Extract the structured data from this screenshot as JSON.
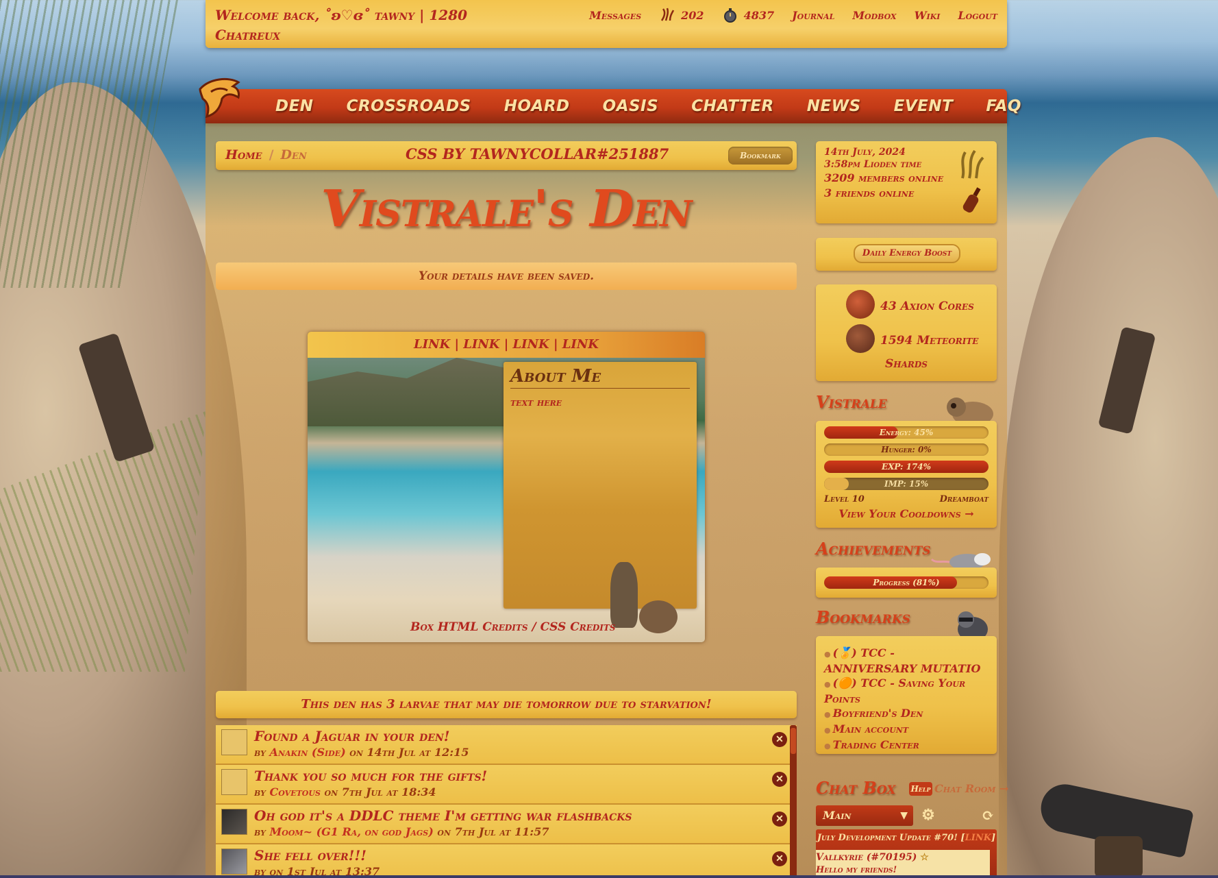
{
  "topbar": {
    "welcome": "Welcome back, ˚ʚ♡ɞ˚ tawny | 1280 Chatreux",
    "links": {
      "messages": "Messages",
      "currency1": "202",
      "currency2": "4837",
      "journal": "Journal",
      "modbox": "Modbox",
      "wiki": "Wiki",
      "logout": "Logout"
    }
  },
  "mainnav": {
    "items": [
      "DEN",
      "CROSSROADS",
      "HOARD",
      "OASIS",
      "CHATTER",
      "NEWS",
      "EVENT",
      "FAQ"
    ]
  },
  "breadcrumb": {
    "home": "Home",
    "separator": "/",
    "current": "Den",
    "credit": "CSS BY TAWNYCOLLAR#251887",
    "bookmark_button": "Bookmark"
  },
  "den": {
    "title": "Vistrale's Den",
    "saved_notice": "Your details have been saved.",
    "profile": {
      "links": "LINK | LINK | LINK | LINK",
      "about_title": "About Me",
      "about_text": "text here",
      "credits_box": "Box HTML Credits",
      "credits_sep": "/",
      "credits_css": "CSS Credits"
    },
    "larvae_notice": "This den has 3 larvae that may die tomorrow due to starvation!"
  },
  "messages": [
    {
      "title": "Found a Jaguar in your den!",
      "by": "by",
      "author": "Anakin (Side)",
      "when": "on 14th Jul at 12:15"
    },
    {
      "title": "Thank you so much for the gifts!",
      "by": "by",
      "author": "Covetous",
      "when": "on 7th Jul at 18:34"
    },
    {
      "title": "Oh god it's a DDLC theme I'm getting war flashbacks",
      "by": "by",
      "author": "Moom~ (G1 Ra, on god Jags)",
      "when": "on 7th Jul at 11:57"
    },
    {
      "title": "She fell over!!!",
      "by": "by",
      "author": "",
      "when": "on 1st Jul at 13:37"
    }
  ],
  "sidebar": {
    "info": {
      "date": "14th July, 2024",
      "time": "3:58pm Lioden time",
      "members_online": "3209 members online",
      "friends_online": "3 friends online"
    },
    "energy_button": "Daily Energy Boost",
    "currencies": {
      "axion": "43 Axion Cores",
      "meteorite_1": "1594 Meteorite",
      "meteorite_2": "Shards"
    },
    "pet": {
      "heading": "Vistrale",
      "energy_label": "Energy: 45%",
      "energy_value": 45,
      "hunger_label": "Hunger: 0%",
      "hunger_value": 0,
      "exp_label": "EXP: 174%",
      "exp_value": 100,
      "imp_label": "IMP: 15%",
      "imp_value": 15,
      "level": "Level 10",
      "type": "Dreamboat",
      "cooldowns": "View Your Cooldowns →"
    },
    "achievements": {
      "heading": "Achievements",
      "progress_label": "Progress (81%)",
      "progress_value": 81
    },
    "bookmarks": {
      "heading": "Bookmarks",
      "items": [
        "(🏅) TCC - ANNIVERSARY MUTATIO",
        "(🟠) TCC - Saving Your Points",
        "Boyfriend's Den",
        "Main account",
        "Trading Center"
      ]
    },
    "chat": {
      "heading": "Chat Box",
      "help": "Help",
      "room_link": "Chat Room →",
      "selected_room": "Main",
      "announcement": "July Development Update #70! [",
      "announcement_link": "LINK",
      "announcement_end": "]",
      "last_author": "Vallkyrie (#70195)",
      "last_text": "Hello my friends!"
    }
  },
  "colors": {
    "accent": "#b3261e",
    "nav_red": "#c23a17",
    "gold": "#efc14a"
  }
}
